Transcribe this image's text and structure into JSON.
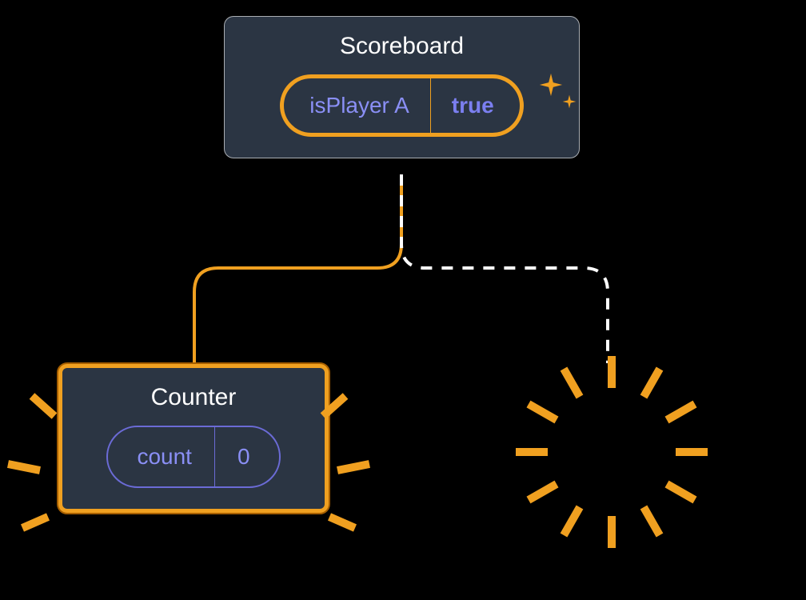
{
  "scoreboard": {
    "title": "Scoreboard",
    "state_label": "isPlayer A",
    "state_value": "true"
  },
  "counter": {
    "title": "Counter",
    "state_label": "count",
    "state_value": "0"
  },
  "icons": {
    "sparkle": "sparkle-icon",
    "burst": "burst-icon"
  },
  "colors": {
    "node_bg": "#2b3543",
    "accent": "#f0a020",
    "purple": "#8a8ff5"
  }
}
